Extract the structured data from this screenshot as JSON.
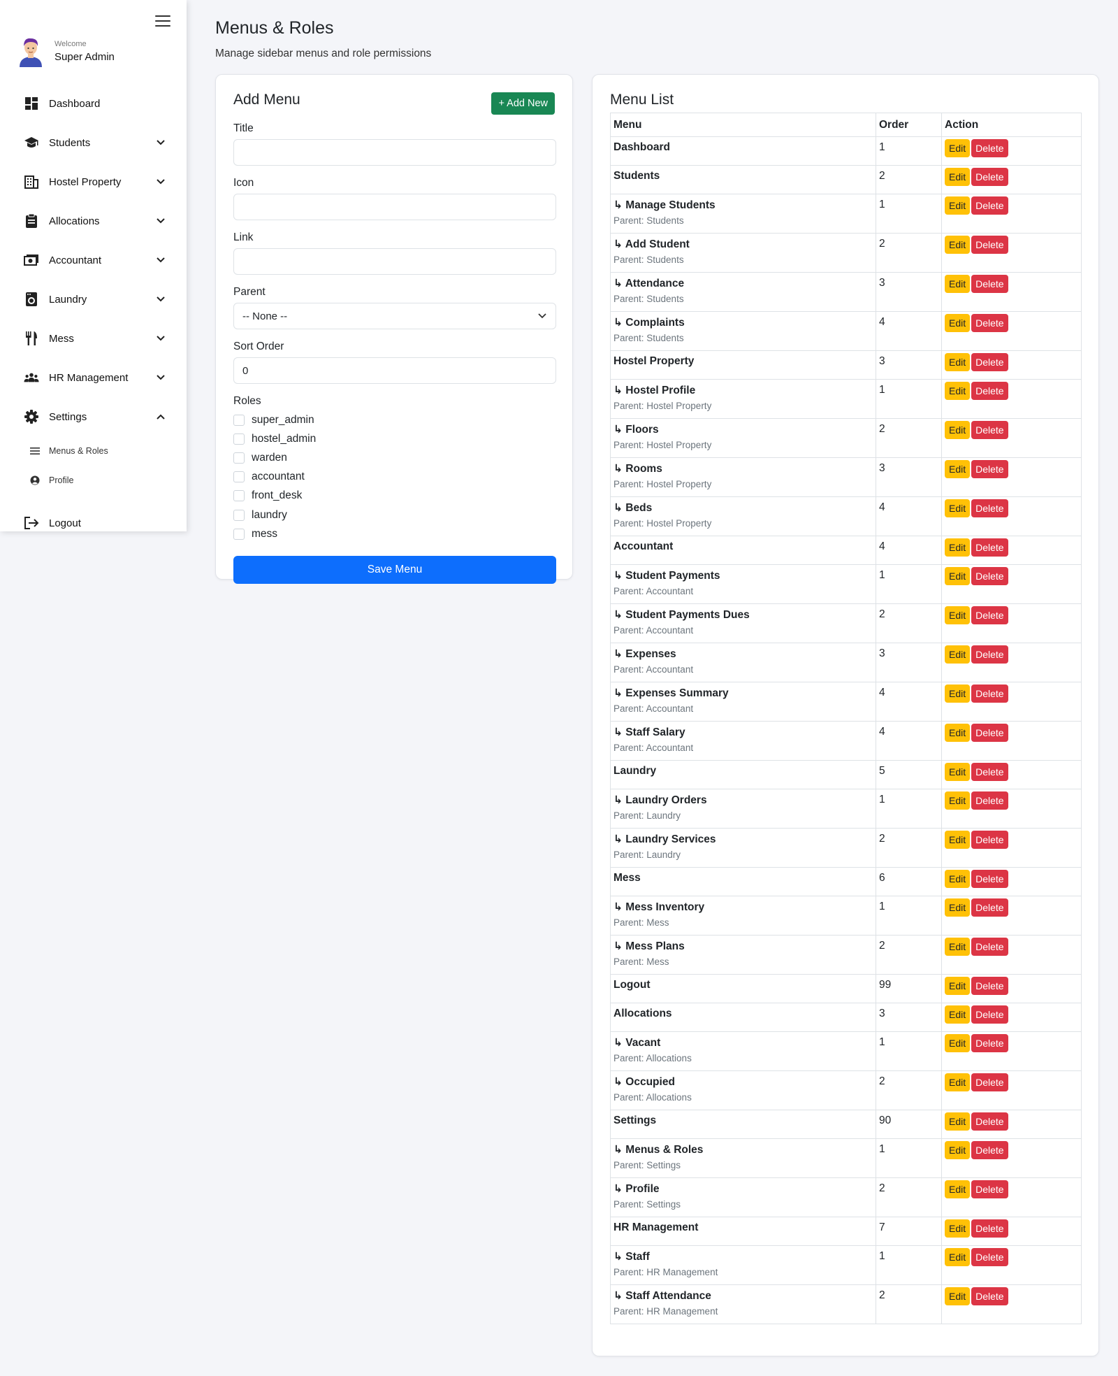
{
  "sidebar": {
    "welcome": "Welcome",
    "user_name": "Super Admin",
    "items": [
      {
        "label": "Dashboard",
        "icon": "dashboard-icon",
        "chevron": false
      },
      {
        "label": "Students",
        "icon": "graduation-cap-icon",
        "chevron": "down"
      },
      {
        "label": "Hostel Property",
        "icon": "building-icon",
        "chevron": "down"
      },
      {
        "label": "Allocations",
        "icon": "clipboard-icon",
        "chevron": "down"
      },
      {
        "label": "Accountant",
        "icon": "money-icon",
        "chevron": "down"
      },
      {
        "label": "Laundry",
        "icon": "washing-machine-icon",
        "chevron": "down"
      },
      {
        "label": "Mess",
        "icon": "utensils-icon",
        "chevron": "down"
      },
      {
        "label": "HR Management",
        "icon": "users-icon",
        "chevron": "down"
      },
      {
        "label": "Settings",
        "icon": "gear-icon",
        "chevron": "up"
      }
    ],
    "sub_items": [
      {
        "label": "Menus & Roles",
        "icon": "menu-lines-icon"
      },
      {
        "label": "Profile",
        "icon": "user-circle-icon"
      }
    ],
    "logout": "Logout"
  },
  "header": {
    "title": "Menus & Roles",
    "subtitle": "Manage sidebar menus and role permissions"
  },
  "add_menu": {
    "title": "Add Menu",
    "add_new": "+ Add New",
    "fields": {
      "title_label": "Title",
      "icon_label": "Icon",
      "link_label": "Link",
      "parent_label": "Parent",
      "parent_value": "-- None --",
      "sort_label": "Sort Order",
      "sort_value": "0",
      "roles_label": "Roles"
    },
    "roles": [
      "super_admin",
      "hostel_admin",
      "warden",
      "accountant",
      "front_desk",
      "laundry",
      "mess"
    ],
    "save": "Save Menu"
  },
  "menu_list": {
    "title": "Menu List",
    "columns": [
      "Menu",
      "Order",
      "Action"
    ],
    "edit_label": "Edit",
    "delete_label": "Delete",
    "rows": [
      {
        "name": "Dashboard",
        "order": "1",
        "parent": ""
      },
      {
        "name": "Students",
        "order": "2",
        "parent": ""
      },
      {
        "name": "↳ Manage Students",
        "order": "1",
        "parent": "Parent: Students"
      },
      {
        "name": "↳ Add Student",
        "order": "2",
        "parent": "Parent: Students"
      },
      {
        "name": "↳ Attendance",
        "order": "3",
        "parent": "Parent: Students"
      },
      {
        "name": "↳ Complaints",
        "order": "4",
        "parent": "Parent: Students"
      },
      {
        "name": "Hostel Property",
        "order": "3",
        "parent": ""
      },
      {
        "name": "↳ Hostel Profile",
        "order": "1",
        "parent": "Parent: Hostel Property"
      },
      {
        "name": "↳ Floors",
        "order": "2",
        "parent": "Parent: Hostel Property"
      },
      {
        "name": "↳ Rooms",
        "order": "3",
        "parent": "Parent: Hostel Property"
      },
      {
        "name": "↳ Beds",
        "order": "4",
        "parent": "Parent: Hostel Property"
      },
      {
        "name": "Accountant",
        "order": "4",
        "parent": ""
      },
      {
        "name": "↳ Student Payments",
        "order": "1",
        "parent": "Parent: Accountant"
      },
      {
        "name": "↳ Student Payments Dues",
        "order": "2",
        "parent": "Parent: Accountant"
      },
      {
        "name": "↳ Expenses",
        "order": "3",
        "parent": "Parent: Accountant"
      },
      {
        "name": "↳ Expenses Summary",
        "order": "4",
        "parent": "Parent: Accountant"
      },
      {
        "name": "↳ Staff Salary",
        "order": "4",
        "parent": "Parent: Accountant"
      },
      {
        "name": "Laundry",
        "order": "5",
        "parent": ""
      },
      {
        "name": "↳ Laundry Orders",
        "order": "1",
        "parent": "Parent: Laundry"
      },
      {
        "name": "↳ Laundry Services",
        "order": "2",
        "parent": "Parent: Laundry"
      },
      {
        "name": "Mess",
        "order": "6",
        "parent": ""
      },
      {
        "name": "↳ Mess Inventory",
        "order": "1",
        "parent": "Parent: Mess"
      },
      {
        "name": "↳ Mess Plans",
        "order": "2",
        "parent": "Parent: Mess"
      },
      {
        "name": "Logout",
        "order": "99",
        "parent": ""
      },
      {
        "name": "Allocations",
        "order": "3",
        "parent": ""
      },
      {
        "name": "↳ Vacant",
        "order": "1",
        "parent": "Parent: Allocations"
      },
      {
        "name": "↳ Occupied",
        "order": "2",
        "parent": "Parent: Allocations"
      },
      {
        "name": "Settings",
        "order": "90",
        "parent": ""
      },
      {
        "name": "↳ Menus & Roles",
        "order": "1",
        "parent": "Parent: Settings"
      },
      {
        "name": "↳ Profile",
        "order": "2",
        "parent": "Parent: Settings"
      },
      {
        "name": "HR Management",
        "order": "7",
        "parent": ""
      },
      {
        "name": "↳ Staff",
        "order": "1",
        "parent": "Parent: HR Management"
      },
      {
        "name": "↳ Staff Attendance",
        "order": "2",
        "parent": "Parent: HR Management"
      }
    ]
  },
  "colors": {
    "primary": "#0d6efd",
    "success": "#198754",
    "warning": "#ffc107",
    "danger": "#dc3545",
    "background": "#f4f5f9"
  }
}
